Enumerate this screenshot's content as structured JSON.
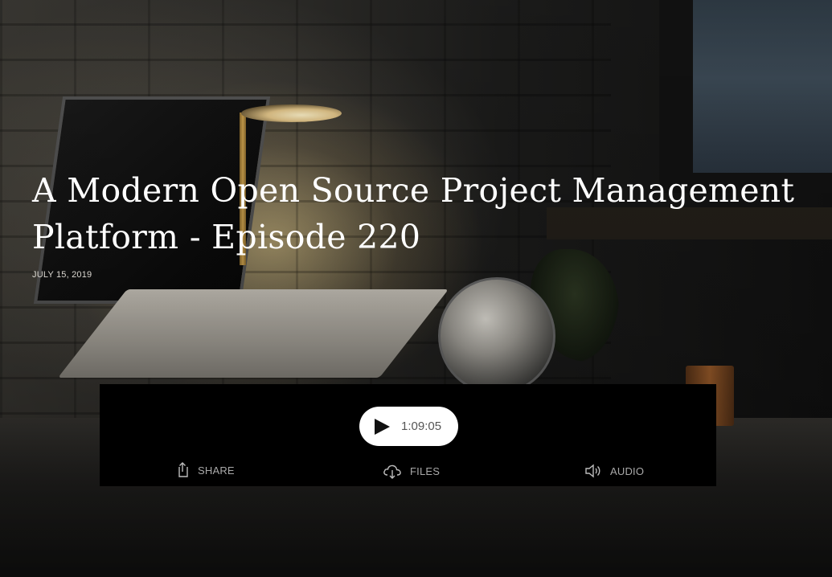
{
  "episode": {
    "title": "A Modern Open Source Project Management Platform - Episode 220",
    "date": "JULY 15, 2019"
  },
  "player": {
    "duration": "1:09:05",
    "play_icon": "play-icon",
    "actions": [
      {
        "label": "SHARE",
        "icon": "share-icon"
      },
      {
        "label": "FILES",
        "icon": "cloud-download-icon"
      },
      {
        "label": "AUDIO",
        "icon": "speaker-icon"
      }
    ]
  },
  "colors": {
    "player_background": "#000000",
    "pill_background": "#ffffff",
    "action_text": "#a9a9a9",
    "title_text": "#ffffff"
  }
}
